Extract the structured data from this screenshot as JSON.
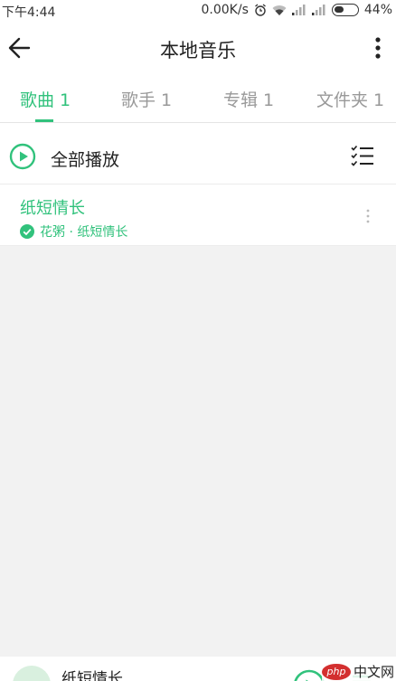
{
  "status_bar": {
    "time": "下午4:44",
    "network_speed": "0.00K/s",
    "battery_percent": "44%",
    "battery_level": 0.44,
    "icons": [
      "alarm-icon",
      "wifi-icon",
      "signal-icon",
      "signal-icon",
      "battery-icon"
    ]
  },
  "app_bar": {
    "title": "本地音乐",
    "back_icon": "back-arrow-icon",
    "more_icon": "more-vertical-icon"
  },
  "tabs": [
    {
      "label": "歌曲 1",
      "active": true
    },
    {
      "label": "歌手 1",
      "active": false
    },
    {
      "label": "专辑 1",
      "active": false
    },
    {
      "label": "文件夹 1",
      "active": false
    }
  ],
  "play_all": {
    "label": "全部播放",
    "play_icon": "play-circle-icon",
    "multiselect_icon": "multiselect-icon"
  },
  "songs": [
    {
      "title": "纸短情长",
      "meta": "花粥 · 纸短情长",
      "status_icon": "downloaded-check-icon",
      "more_icon": "more-vertical-icon"
    }
  ],
  "mini_player": {
    "title": "纸短情长",
    "play_icon": "play-circle-icon",
    "playlist_icon": "playlist-icon"
  },
  "watermark": {
    "logo_text": "php",
    "text": "中文网"
  },
  "colors": {
    "accent": "#31c27c",
    "background": "#f2f2f2",
    "surface": "#ffffff",
    "text_primary": "#222222",
    "text_secondary": "#999999"
  }
}
